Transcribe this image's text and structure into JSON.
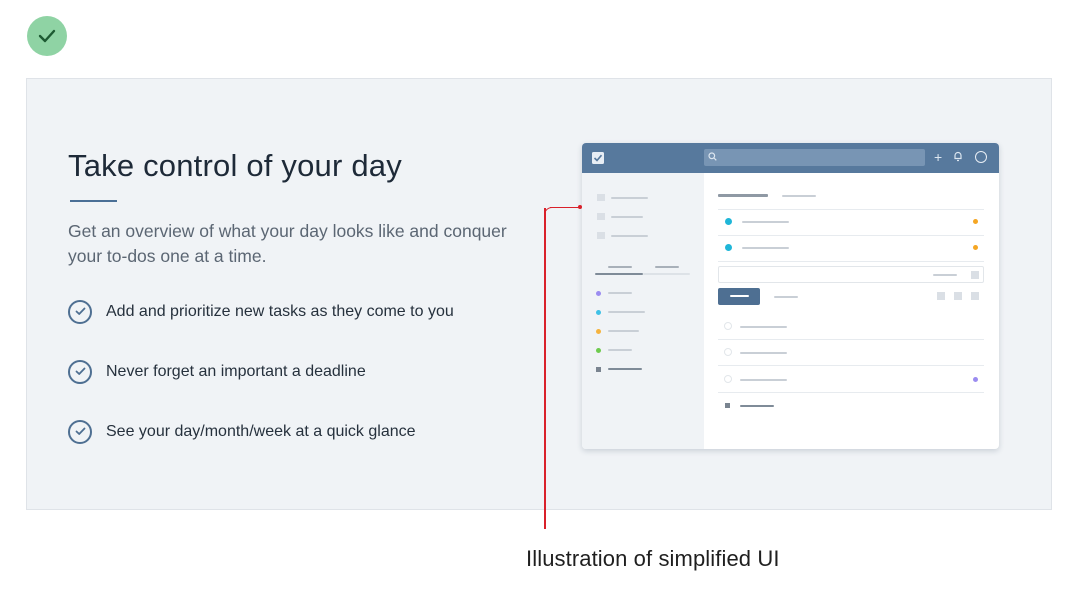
{
  "status": {
    "icon": "checkmark-icon",
    "color": "#8fd3a4"
  },
  "hero": {
    "title": "Take control of your day",
    "subtitle": "Get an overview of what your day looks like and conquer your to-dos one at a time.",
    "features": [
      {
        "icon": "check-circle-icon",
        "text": "Add and prioritize new tasks as they come to you"
      },
      {
        "icon": "check-circle-icon",
        "text": "Never forget an important a deadline"
      },
      {
        "icon": "check-circle-icon",
        "text": "See your day/month/week at a quick glance"
      }
    ]
  },
  "mockup": {
    "topbar_color": "#57799d",
    "icons": [
      "app-logo-icon",
      "search-icon",
      "plus-icon",
      "bell-icon",
      "avatar-icon"
    ],
    "project_colors": [
      "#9b8cf0",
      "#3fc1e6",
      "#f5b33e",
      "#6ecb4e",
      "#7a8490"
    ],
    "priority_color": "#f5a623",
    "task_dot_color": "#1fb6d8",
    "button_color": "#4e6f92"
  },
  "annotation": {
    "caption": "Illustration of simplified UI",
    "color": "#d9202a"
  }
}
